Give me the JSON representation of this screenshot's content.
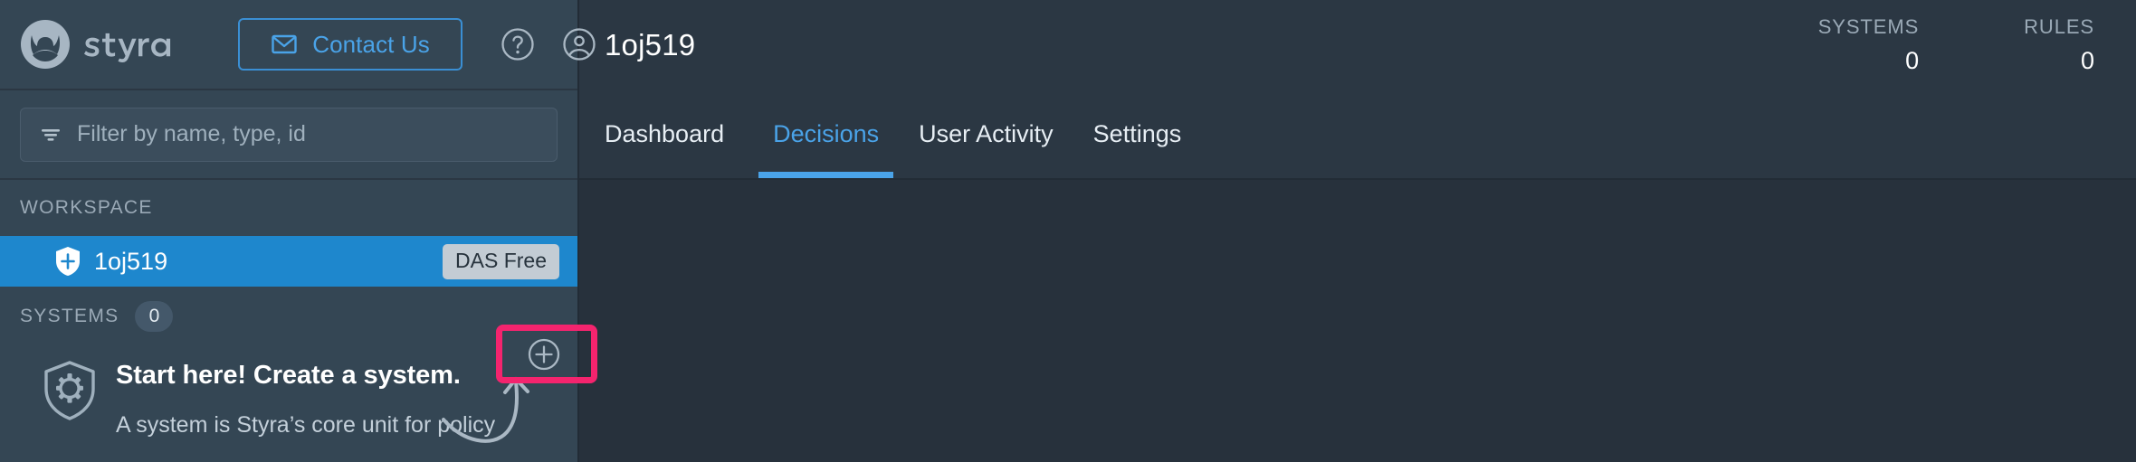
{
  "brand": {
    "name": "styra",
    "logo_icon": "styra-helmet-logo"
  },
  "sidebar": {
    "contact_button": {
      "label": "Contact Us",
      "icon": "mail-icon",
      "accent": "#4aa3e8"
    },
    "header_icons": [
      {
        "name": "help-icon",
        "glyph": "?"
      },
      {
        "name": "account-icon",
        "glyph": "person"
      }
    ],
    "filter": {
      "placeholder": "Filter by name, type, id",
      "value": "",
      "icon": "filter-icon"
    },
    "workspace_section": {
      "label": "WORKSPACE",
      "item": {
        "name": "1oj519",
        "icon": "shield-icon",
        "badge": "DAS Free",
        "selected": true,
        "selected_color": "#1e87cd"
      }
    },
    "systems_section": {
      "label": "SYSTEMS",
      "count": "0",
      "add_button_icon": "plus-circle-icon",
      "empty_state": {
        "icon": "shield-gear-icon",
        "title": "Start here! Create a system.",
        "description": "A system is Styra’s core unit for policy"
      }
    }
  },
  "highlight": {
    "color": "#f4246e",
    "target": "add-system-button"
  },
  "main": {
    "title": "1oj519",
    "stats": [
      {
        "label": "SYSTEMS",
        "value": "0"
      },
      {
        "label": "RULES",
        "value": "0"
      }
    ],
    "tabs": [
      {
        "label": "Dashboard",
        "active": false
      },
      {
        "label": "Decisions",
        "active": true
      },
      {
        "label": "User Activity",
        "active": false
      },
      {
        "label": "Settings",
        "active": false
      }
    ],
    "active_tab_color": "#4aa3e8"
  }
}
